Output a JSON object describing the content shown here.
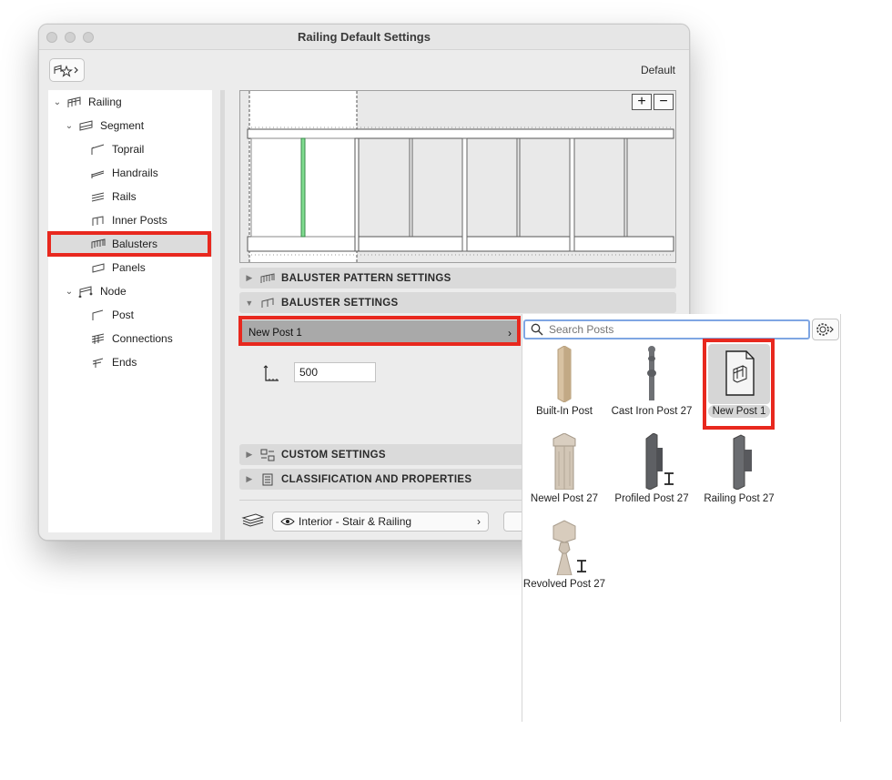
{
  "window": {
    "title": "Railing Default Settings",
    "favorites_label": "Default"
  },
  "tree": {
    "items": [
      {
        "label": "Railing",
        "icon": "railing-icon"
      },
      {
        "label": "Segment",
        "icon": "segment-icon"
      },
      {
        "label": "Toprail",
        "icon": "toprail-icon"
      },
      {
        "label": "Handrails",
        "icon": "handrails-icon"
      },
      {
        "label": "Rails",
        "icon": "rails-icon"
      },
      {
        "label": "Inner Posts",
        "icon": "inner-posts-icon"
      },
      {
        "label": "Balusters",
        "icon": "balusters-icon"
      },
      {
        "label": "Panels",
        "icon": "panels-icon"
      },
      {
        "label": "Node",
        "icon": "node-icon"
      },
      {
        "label": "Post",
        "icon": "post-icon"
      },
      {
        "label": "Connections",
        "icon": "connections-icon"
      },
      {
        "label": "Ends",
        "icon": "ends-icon"
      }
    ],
    "selected": "Balusters"
  },
  "sections": {
    "pattern": "BALUSTER PATTERN SETTINGS",
    "baluster": "BALUSTER SETTINGS",
    "custom": "CUSTOM SETTINGS",
    "classification": "CLASSIFICATION AND PROPERTIES"
  },
  "baluster_settings": {
    "selected_post": "New Post 1",
    "height_value": "500"
  },
  "layer": {
    "value": "Interior - Stair & Railing"
  },
  "post_picker": {
    "search_placeholder": "Search Posts",
    "posts": [
      {
        "name": "Built-In Post"
      },
      {
        "name": "Cast Iron Post 27"
      },
      {
        "name": "New Post 1"
      },
      {
        "name": "Newel Post 27"
      },
      {
        "name": "Profiled Post 27"
      },
      {
        "name": "Railing Post 27"
      },
      {
        "name": "Revolved Post 27"
      }
    ],
    "selected": "New Post 1"
  },
  "colors": {
    "highlight": "#e8281e",
    "search_focus": "#7fa6e3",
    "selected_baluster": "#7fdc8f"
  }
}
